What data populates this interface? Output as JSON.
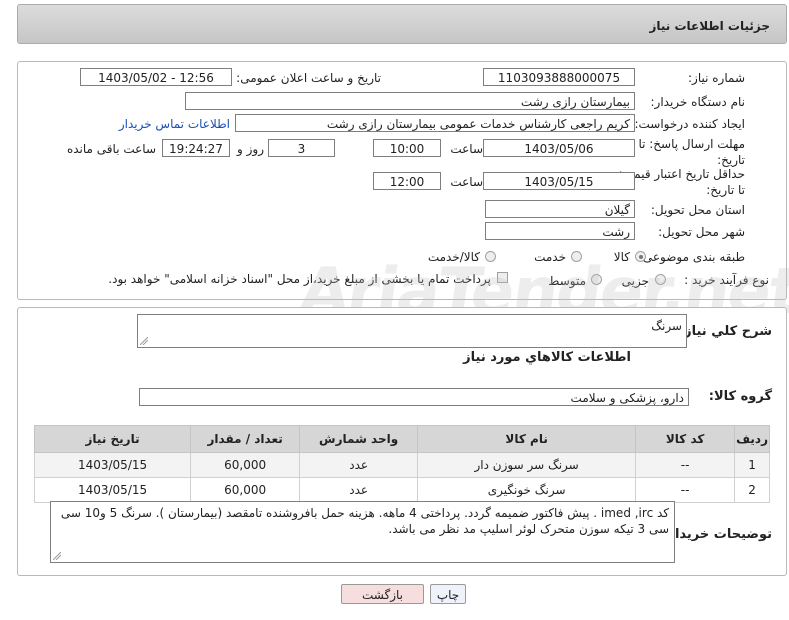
{
  "header": {
    "title": "جزئیات اطلاعات نیاز"
  },
  "form": {
    "need_number": {
      "label": "شماره نیاز:",
      "value": "1103093888000075"
    },
    "announce_datetime": {
      "label": "تاریخ و ساعت اعلان عمومی:",
      "value": "1403/05/02 - 12:56"
    },
    "buyer_org": {
      "label": "نام دستگاه خریدار:",
      "value": "بیمارستان رازی رشت"
    },
    "requester": {
      "label": "ایجاد کننده درخواست:",
      "value": "کریم راجعی کارشناس خدمات عمومی بیمارستان رازی رشت",
      "contact_link": "اطلاعات تماس خریدار"
    },
    "reply_deadline": {
      "label": "مهلت ارسال پاسخ: تا تاریخ:",
      "date": "1403/05/06",
      "time_label": "ساعت",
      "time": "10:00",
      "days": "3",
      "days_label": "روز و",
      "remaining": "19:24:27",
      "remaining_label": "ساعت باقی مانده"
    },
    "price_validity": {
      "label": "حداقل تاریخ اعتبار قیمت: تا تاریخ:",
      "date": "1403/05/15",
      "time_label": "ساعت",
      "time": "12:00"
    },
    "province": {
      "label": "استان محل تحویل:",
      "value": "گیلان"
    },
    "city": {
      "label": "شهر محل تحویل:",
      "value": "رشت"
    },
    "category": {
      "label": "طبقه بندی موضوعی:",
      "options": [
        "کالا",
        "خدمت",
        "کالا/خدمت"
      ],
      "selected": "کالا"
    },
    "process_type": {
      "label": "نوع فرآیند خرید :",
      "options": [
        "جزیی",
        "متوسط"
      ],
      "payment_note": "پرداخت تمام یا بخشی از مبلغ خرید،از محل \"اسناد خزانه اسلامی\" خواهد بود."
    }
  },
  "details": {
    "summary_label": "شرح کلي نياز:",
    "summary_value": "سرنگ",
    "items_heading": "اطلاعات کالاهاي مورد نياز",
    "group_label": "گروه کالا:",
    "group_value": "دارو، پزشکی و سلامت",
    "table": {
      "headers": [
        "ردیف",
        "کد کالا",
        "نام کالا",
        "واحد شمارش",
        "تعداد / مقدار",
        "تاریخ نیاز"
      ],
      "rows": [
        [
          "1",
          "--",
          "سرنگ سر سوزن دار",
          "عدد",
          "60,000",
          "1403/05/15"
        ],
        [
          "2",
          "--",
          "سرنگ خونگیری",
          "عدد",
          "60,000",
          "1403/05/15"
        ]
      ]
    },
    "buyer_notes_label": "توضیحات خریدار:",
    "buyer_notes": "کد imed ,irc . پیش فاکتور ضمیمه گردد. پرداختی 4 ماهه. هزینه حمل بافروشنده تامقصد (بیمارستان ). سرنگ 5 و10 سی سی 3 تیکه سوزن متحرک لوئر اسلیپ مد نظر می باشد."
  },
  "buttons": {
    "print": "چاپ",
    "back": "بازگشت"
  },
  "watermark": "AriaTender.net",
  "colors": {
    "accent_link": "#1b4fb5",
    "back_button_bg": "#f7dede",
    "print_button_bg": "#eef3fb"
  }
}
